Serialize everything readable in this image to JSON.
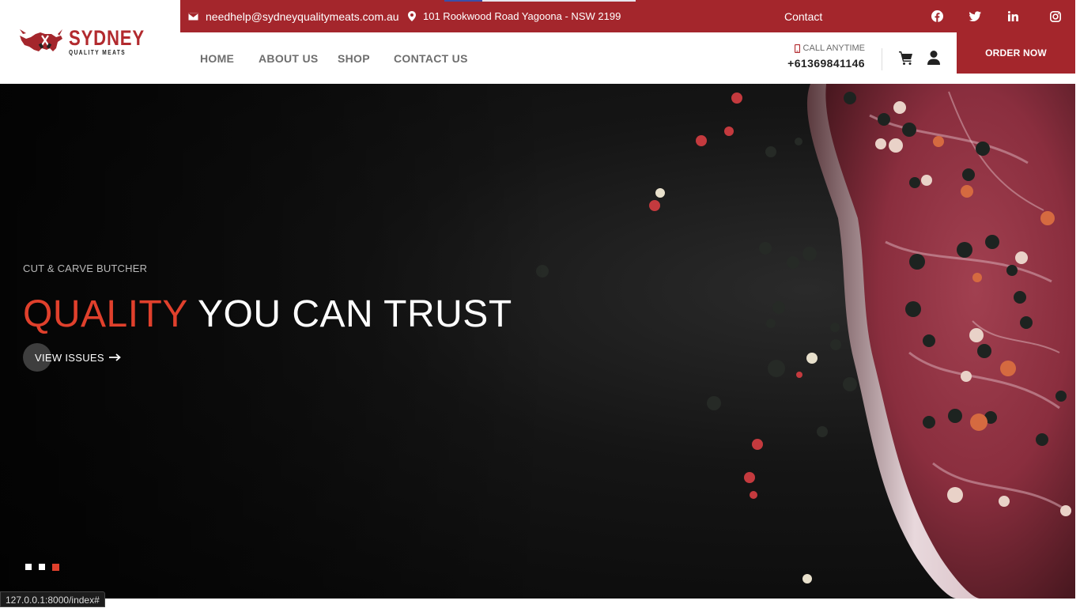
{
  "brand": {
    "name": "SYDNEY",
    "tagline": "QUALITY MEATS"
  },
  "topbar": {
    "email": "needhelp@sydneyqualitymeats.com.au",
    "address": "101 Rookwood Road Yagoona - NSW 2199",
    "contact_label": "Contact",
    "social": [
      "facebook-icon",
      "twitter-icon",
      "linkedin-icon",
      "instagram-icon"
    ],
    "background_color": "#a4262c"
  },
  "nav": {
    "items": [
      {
        "label": "HOME"
      },
      {
        "label": "ABOUT US"
      },
      {
        "label": "SHOP"
      },
      {
        "label": "CONTACT US"
      }
    ],
    "call_label": "CALL ANYTIME",
    "phone": "+61369841146",
    "order_button": "ORDER NOW"
  },
  "hero": {
    "kicker": "CUT & CARVE BUTCHER",
    "title_accent": "QUALITY",
    "title_rest": "YOU CAN TRUST",
    "cta": "VIEW ISSUES",
    "slides_total": 3,
    "active_slide": 3,
    "accent_color": "#e0402c"
  },
  "status_bar": {
    "url": "127.0.0.1:8000/index#"
  }
}
